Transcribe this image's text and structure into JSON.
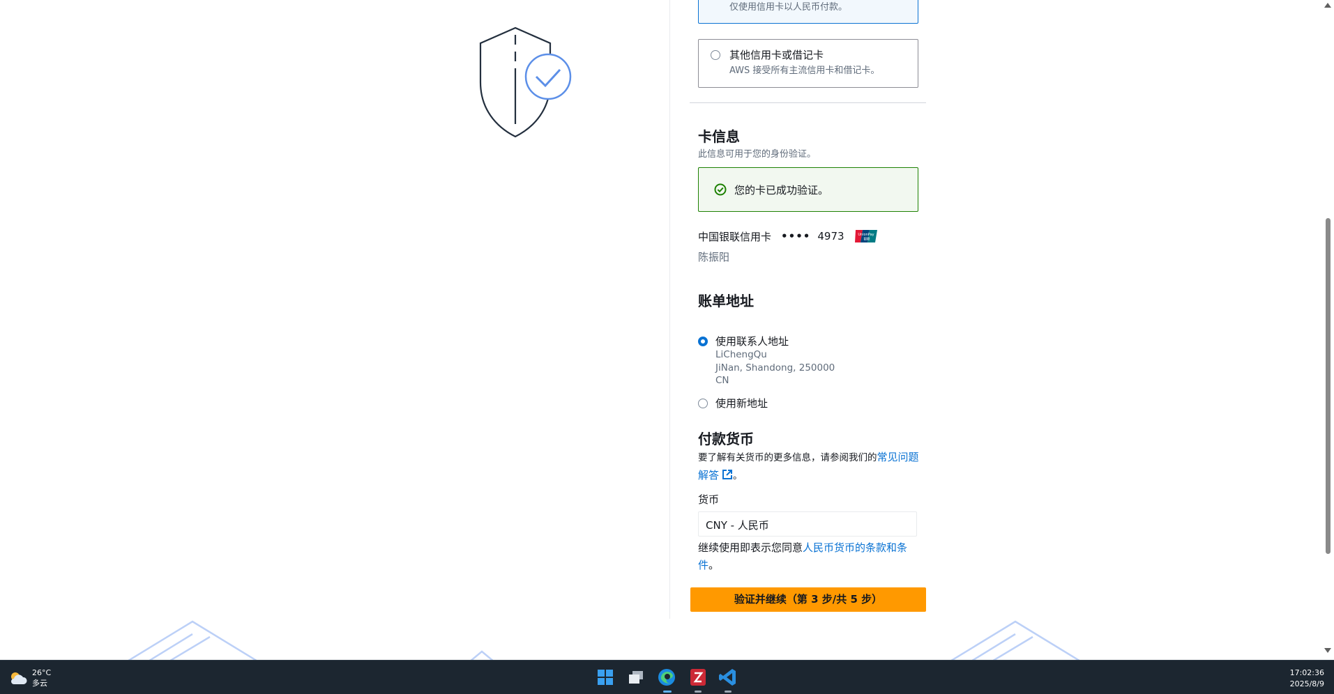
{
  "payment_options": {
    "selected_sub": "仅使用信用卡以人民币付款。",
    "other_title": "其他信用卡或借记卡",
    "other_sub": "AWS 接受所有主流信用卡和借记卡。"
  },
  "card_info": {
    "title": "卡信息",
    "desc": "此信息可用于您的身份验证。",
    "success": "您的卡已成功验证。",
    "card_type": "中国银联信用卡",
    "mask": "••••",
    "last4": "4973",
    "holder": "陈振阳"
  },
  "billing": {
    "title": "账单地址",
    "use_contact": "使用联系人地址",
    "address_lines": [
      "LiChengQu",
      "JiNan, Shandong, 250000",
      "CN"
    ],
    "use_new": "使用新地址"
  },
  "currency": {
    "title": "付款货币",
    "desc_prefix": "要了解有关货币的更多信息，请参阅我们的",
    "faq_link": "常见问题解答",
    "desc_suffix": "。",
    "field_label": "货币",
    "selected": "CNY - 人民币",
    "terms_prefix": "继续使用即表示您同意",
    "terms_link": "人民币货币的条款和条件",
    "terms_suffix": "。"
  },
  "cta": {
    "label": "验证并继续（第 3 步/共 5 步）"
  },
  "taskbar": {
    "temp": "26°C",
    "weather": "多云",
    "time": "17:02:36",
    "date": "2025/8/9"
  },
  "colors": {
    "accent": "#0972d3",
    "cta": "#ff9900",
    "success": "#1d8102"
  }
}
